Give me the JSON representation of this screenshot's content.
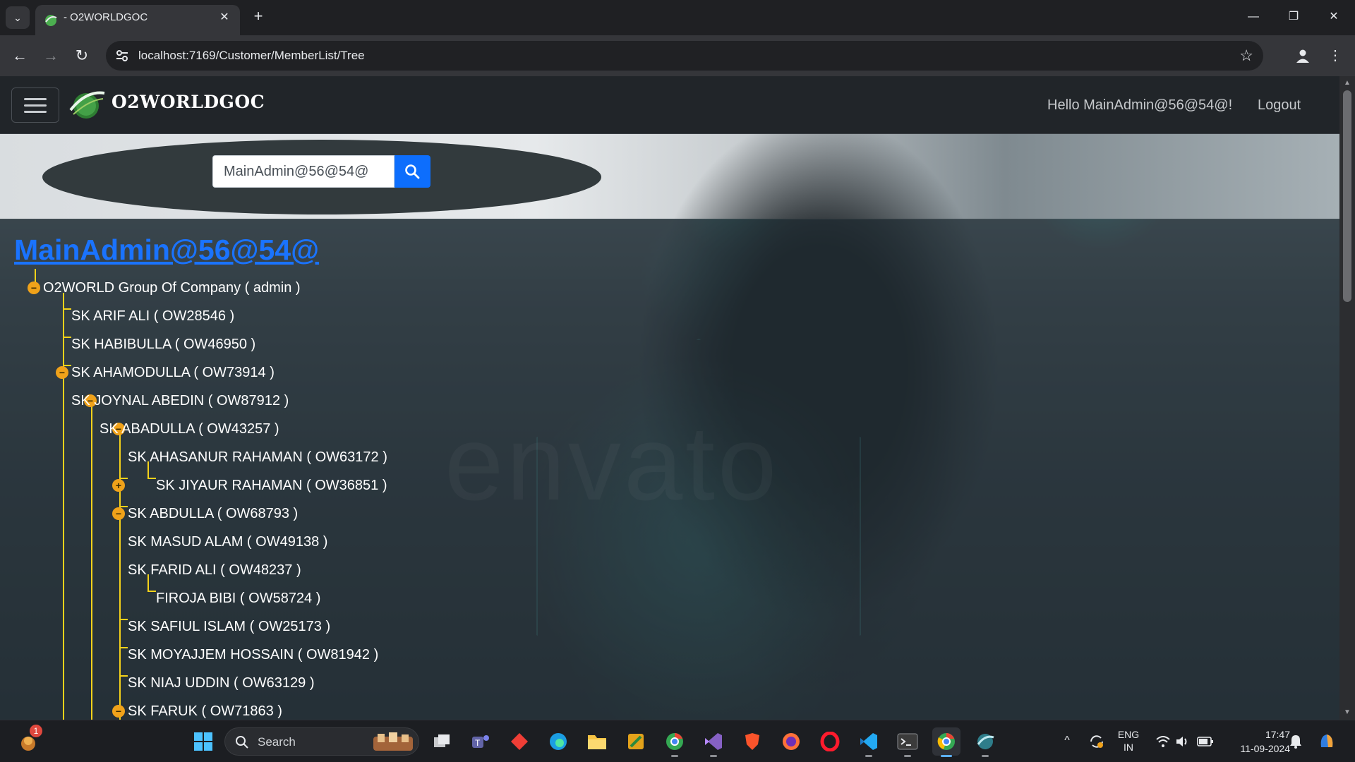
{
  "browser": {
    "tab_title": "- O2WORLDGOC",
    "url": "localhost:7169/Customer/MemberList/Tree"
  },
  "navbar": {
    "brand": "O2WORLDGOC",
    "greeting": "Hello MainAdmin@56@54@!",
    "logout_label": "Logout"
  },
  "search": {
    "value": "MainAdmin@56@54@"
  },
  "tree": {
    "title": "MainAdmin@56@54@",
    "nodes": [
      {
        "label": "O2WORLD Group Of Company ( admin )",
        "toggle": "−"
      },
      {
        "label": "SK ARIF ALI ( OW28546 )",
        "toggle": ""
      },
      {
        "label": "SK HABIBULLA ( OW46950 )",
        "toggle": ""
      },
      {
        "label": "SK AHAMODULLA ( OW73914 )",
        "toggle": ""
      },
      {
        "label": "SK JOYNAL ABEDIN ( OW87912 )",
        "toggle": "−"
      },
      {
        "label": "SK ABADULLA ( OW43257 )",
        "toggle": "−"
      },
      {
        "label": "SK AHASANUR RAHAMAN ( OW63172 )",
        "toggle": "−"
      },
      {
        "label": "SK JIYAUR RAHAMAN ( OW36851 )",
        "toggle": ""
      },
      {
        "label": "SK ABDULLA ( OW68793 )",
        "toggle": ""
      },
      {
        "label": "SK MASUD ALAM ( OW49138 )",
        "toggle": "+"
      },
      {
        "label": "SK FARID ALI ( OW48237 )",
        "toggle": "−"
      },
      {
        "label": "FIROJA BIBI ( OW58724 )",
        "toggle": ""
      },
      {
        "label": "SK SAFIUL ISLAM ( OW25173 )",
        "toggle": ""
      },
      {
        "label": "SK MOYAJJEM HOSSAIN ( OW81942 )",
        "toggle": ""
      },
      {
        "label": "SK NIAJ UDDIN ( OW63129 )",
        "toggle": ""
      },
      {
        "label": "SK FARUK ( OW71863 )",
        "toggle": "−"
      }
    ]
  },
  "hero": {
    "watermark": "envato"
  },
  "taskbar": {
    "search_label": "Search",
    "notification_count": "1",
    "lang_line1": "ENG",
    "lang_line2": "IN",
    "time": "17:47",
    "date": "11-09-2024"
  },
  "colors": {
    "accent": "#0d6efd",
    "tree_line": "#f5d21a",
    "toggle": "#f0a21a",
    "title_link": "#1a73ff"
  }
}
